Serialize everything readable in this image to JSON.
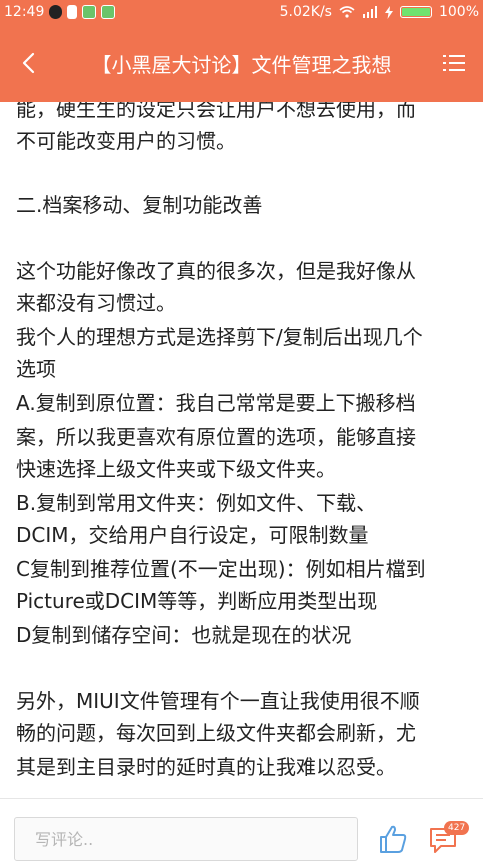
{
  "status_bar": {
    "time": "12:49",
    "network_speed": "5.02K/s",
    "battery_level": 1.0,
    "battery_text": "100%",
    "icons": [
      "qq-icon",
      "notification-icon",
      "wechat-icon",
      "wechat-icon",
      "wifi-icon",
      "signal-icon",
      "charging-icon",
      "battery-icon"
    ]
  },
  "header": {
    "title": "【小黑屋大讨论】文件管理之我想",
    "back_icon": "chevron-left-icon",
    "menu_icon": "list-menu-icon",
    "color": "#f1734f"
  },
  "article": {
    "lines": [
      "能，硬生生的设定只会让用户不想去使用，而",
      "不可能改变用户的习惯。",
      "",
      "二.档案移动、复制功能改善",
      "",
      "这个功能好像改了真的很多次，但是我好像从",
      "来都没有习惯过。",
      "我个人的理想方式是选择剪下/复制后出现几个",
      "选项",
      "A.复制到原位置：我自己常常是要上下搬移档",
      "案，所以我更喜欢有原位置的选项，能够直接",
      "快速选择上级文件夹或下级文件夹。",
      "B.复制到常用文件夹：例如文件、下载、",
      "DCIM，交给用户自行设定，可限制数量",
      "C复制到推荐位置(不一定出现)：例如相片檔到",
      "Picture或DCIM等等，判断应用类型出现",
      "D复制到储存空间：也就是现在的状况",
      "",
      "另外，MIUI文件管理有个一直让我使用很不顺",
      "畅的问题，每次回到上级文件夹都会刷新，尤",
      "其是到主目录时的延时真的让我难以忍受。"
    ]
  },
  "footer": {
    "comment_placeholder": "写评论..",
    "like_icon": "thumbs-up-icon",
    "message_icon": "comment-icon",
    "comment_count": "427"
  }
}
